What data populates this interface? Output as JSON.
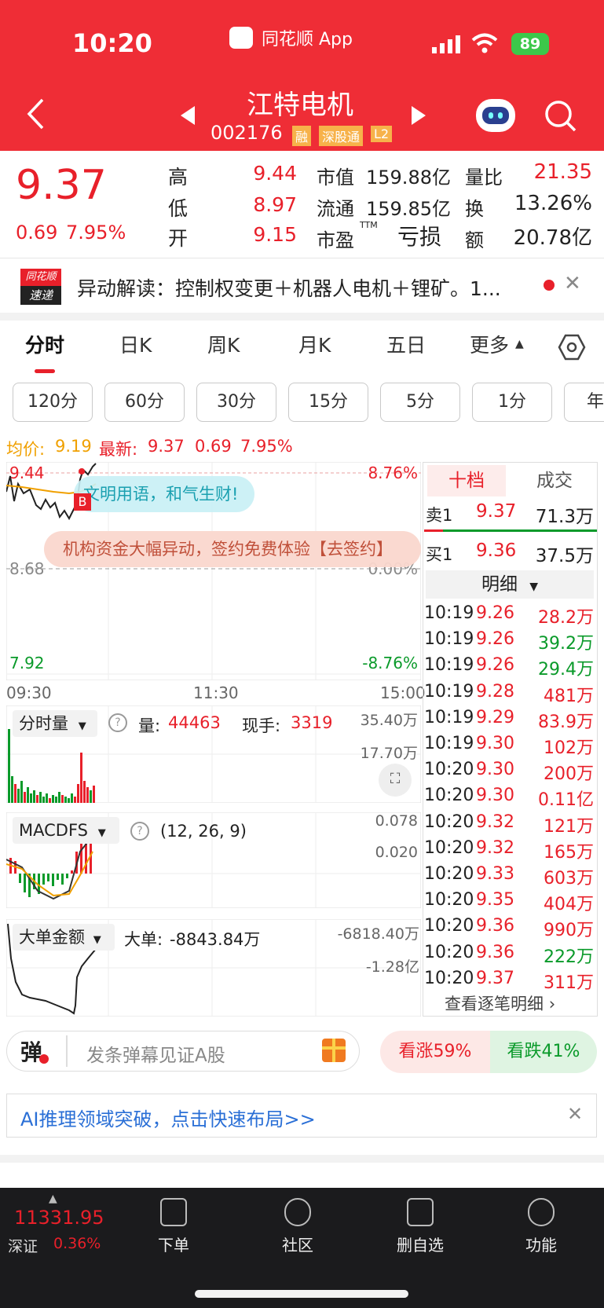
{
  "status": {
    "time": "10:20",
    "app": "同花顺 App",
    "battery": "89"
  },
  "stock": {
    "name": "江特电机",
    "code": "002176",
    "tags": [
      "融",
      "深股通",
      "L2"
    ]
  },
  "quote": {
    "price": "9.37",
    "change": "0.69",
    "pct": "7.95%",
    "cells": [
      {
        "label": "高",
        "value": "9.44"
      },
      {
        "label": "低",
        "value": "8.97"
      },
      {
        "label": "开",
        "value": "9.15"
      },
      {
        "label": "市值",
        "value": "159.88亿"
      },
      {
        "label": "流通",
        "value": "159.85亿"
      },
      {
        "label": "市盈",
        "sup": "TTM",
        "value": "亏损"
      },
      {
        "label": "量比",
        "value": "21.35"
      },
      {
        "label": "换",
        "value": "13.26%"
      },
      {
        "label": "额",
        "value": "20.78亿"
      }
    ]
  },
  "news": {
    "logo_top": "同花顺",
    "logo_bottom": "速递",
    "text": "异动解读：控制权变更＋机器人电机＋锂矿。1..."
  },
  "tabs": [
    "分时",
    "日K",
    "周K",
    "月K",
    "五日",
    "更多"
  ],
  "periods": [
    "120分",
    "60分",
    "30分",
    "15分",
    "5分",
    "1分",
    "年"
  ],
  "chart": {
    "avg_label": "均价:",
    "avg": "9.19",
    "latest_label": "最新:",
    "latest": "9.37",
    "chg": "0.69",
    "pct": "7.95%",
    "y_high": "9.44",
    "y_mid": "8.68",
    "y_low": "7.92",
    "p_high": "8.76%",
    "p_mid": "0.00%",
    "p_low": "-8.76%",
    "x": [
      "09:30",
      "11:30",
      "15:00"
    ],
    "bubble1": "文明用语，和气生财!",
    "bubble2": "机构资金大幅异动，签约免费体验【去签约】",
    "marker": "B"
  },
  "chart_data": {
    "type": "line",
    "x": [
      "09:30",
      "09:35",
      "09:40",
      "09:45",
      "09:50",
      "09:55",
      "10:00",
      "10:05",
      "10:10",
      "10:15",
      "10:20"
    ],
    "series": [
      {
        "values": [
          9.1,
          9.05,
          9.12,
          8.99,
          9.0,
          9.05,
          8.97,
          9.02,
          9.15,
          9.3,
          9.37
        ]
      },
      {
        "values": [
          9.15,
          9.14,
          9.12,
          9.1,
          9.09,
          9.08,
          9.07,
          9.08,
          9.09,
          9.12,
          9.19
        ]
      }
    ],
    "ylim": [
      7.92,
      9.44
    ]
  },
  "vol": {
    "label": "分时量",
    "q_label": "量:",
    "q": "44463",
    "hand_label": "现手:",
    "hand": "3319",
    "s1": "35.40万",
    "s2": "17.70万"
  },
  "macd": {
    "label": "MACDFS",
    "params": "(12, 26, 9)",
    "s1": "0.078",
    "s2": "0.020"
  },
  "big": {
    "label": "大单金额",
    "sub_label": "大单:",
    "sub": "-8843.84万",
    "s1": "-6818.40万",
    "s2": "-1.28亿"
  },
  "book": {
    "tab1": "十档",
    "tab2": "成交",
    "sell_label": "卖1",
    "sell_price": "9.37",
    "sell_vol": "71.3万",
    "buy_label": "买1",
    "buy_price": "9.36",
    "buy_vol": "37.5万",
    "detail": "明细"
  },
  "trades": [
    {
      "t": "10:19",
      "p": "9.26",
      "v": "28.2万",
      "c": "red"
    },
    {
      "t": "10:19",
      "p": "9.26",
      "v": "39.2万",
      "c": "green"
    },
    {
      "t": "10:19",
      "p": "9.26",
      "v": "29.4万",
      "c": "green"
    },
    {
      "t": "10:19",
      "p": "9.28",
      "v": "481万",
      "c": "red"
    },
    {
      "t": "10:19",
      "p": "9.29",
      "v": "83.9万",
      "c": "red"
    },
    {
      "t": "10:19",
      "p": "9.30",
      "v": "102万",
      "c": "red"
    },
    {
      "t": "10:20",
      "p": "9.30",
      "v": "200万",
      "c": "red"
    },
    {
      "t": "10:20",
      "p": "9.30",
      "v": "0.11亿",
      "c": "red"
    },
    {
      "t": "10:20",
      "p": "9.32",
      "v": "121万",
      "c": "red"
    },
    {
      "t": "10:20",
      "p": "9.32",
      "v": "165万",
      "c": "red"
    },
    {
      "t": "10:20",
      "p": "9.33",
      "v": "603万",
      "c": "red"
    },
    {
      "t": "10:20",
      "p": "9.35",
      "v": "404万",
      "c": "red"
    },
    {
      "t": "10:20",
      "p": "9.36",
      "v": "990万",
      "c": "red"
    },
    {
      "t": "10:20",
      "p": "9.36",
      "v": "222万",
      "c": "green"
    },
    {
      "t": "10:20",
      "p": "9.37",
      "v": "311万",
      "c": "red"
    }
  ],
  "trades_more": "查看逐笔明细",
  "danmu": {
    "icon": "弹",
    "placeholder": "发条弹幕见证A股",
    "up": "看涨59%",
    "down": "看跌41%"
  },
  "ad": {
    "text": "AI推理领域突破，点击快速布局>>"
  },
  "index": {
    "value": "11331.95",
    "name": "深证",
    "pct": "0.36%"
  },
  "nav": [
    "下单",
    "社区",
    "删自选",
    "功能"
  ],
  "colors": {
    "brand": "#ef2d36",
    "up": "#e8202a",
    "down": "#0a9a2a"
  }
}
